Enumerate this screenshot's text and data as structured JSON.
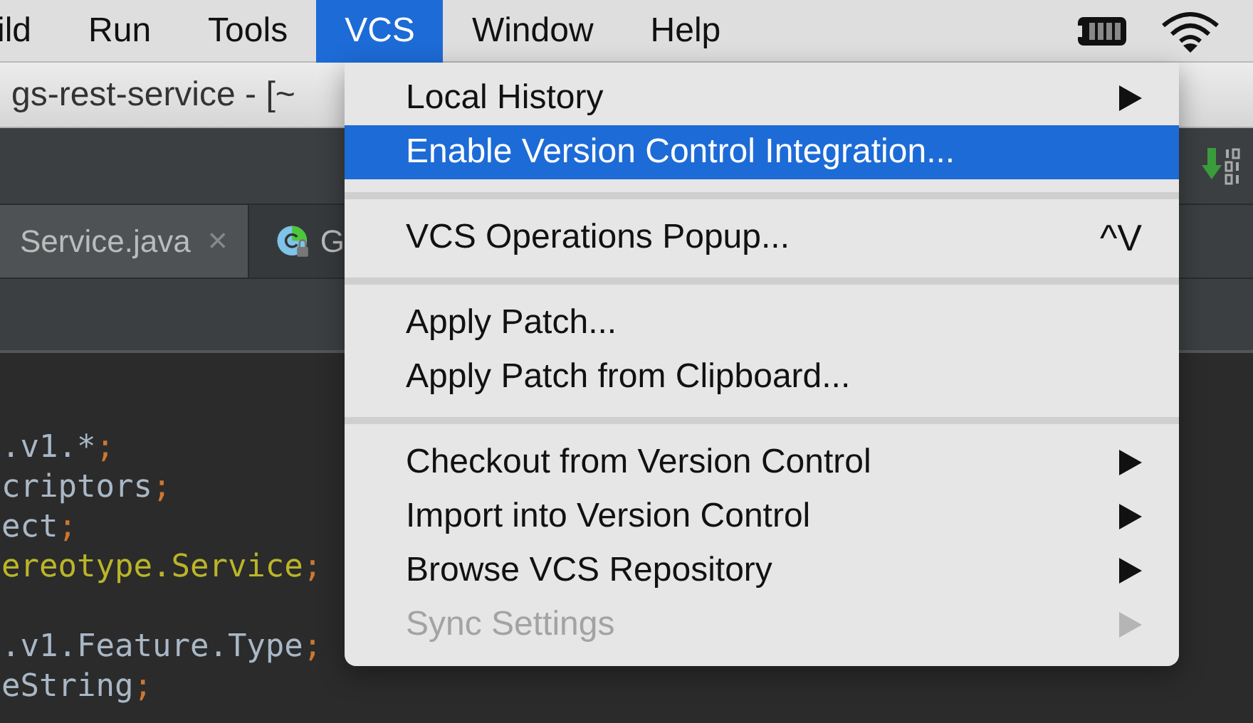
{
  "menubar": {
    "items": [
      {
        "label": "ild",
        "selected": false
      },
      {
        "label": "Run",
        "selected": false
      },
      {
        "label": "Tools",
        "selected": false
      },
      {
        "label": "VCS",
        "selected": true
      },
      {
        "label": "Window",
        "selected": false
      },
      {
        "label": "Help",
        "selected": false
      }
    ]
  },
  "window": {
    "title": "gs-rest-service - [~"
  },
  "tabs": [
    {
      "label": "Service.java",
      "close": "×",
      "selected": true
    },
    {
      "label": "G",
      "selected": false
    }
  ],
  "code_lines": [
    {
      "tokens": [
        {
          "text": ".v1.*",
          "kind": "plain"
        },
        {
          "text": ";",
          "kind": "punct"
        }
      ]
    },
    {
      "tokens": [
        {
          "text": "criptors",
          "kind": "plain"
        },
        {
          "text": ";",
          "kind": "punct"
        }
      ]
    },
    {
      "tokens": [
        {
          "text": "ect",
          "kind": "plain"
        },
        {
          "text": ";",
          "kind": "punct"
        }
      ]
    },
    {
      "tokens": [
        {
          "text": "ereotype.Service",
          "kind": "annotation"
        },
        {
          "text": ";",
          "kind": "punct"
        }
      ]
    },
    {
      "kind": "blank"
    },
    {
      "tokens": [
        {
          "text": ".v1.Feature.Type",
          "kind": "plain"
        },
        {
          "text": ";",
          "kind": "punct"
        }
      ]
    },
    {
      "tokens": [
        {
          "text": "eString",
          "kind": "plain"
        },
        {
          "text": ";",
          "kind": "punct"
        }
      ]
    }
  ],
  "menu": {
    "groups": [
      [
        {
          "label": "Local History",
          "submenu": true,
          "selected": false,
          "disabled": false
        },
        {
          "label": "Enable Version Control Integration...",
          "submenu": false,
          "selected": true,
          "disabled": false
        }
      ],
      [
        {
          "label": "VCS Operations Popup...",
          "shortcut": "^V",
          "submenu": false,
          "selected": false,
          "disabled": false
        }
      ],
      [
        {
          "label": "Apply Patch...",
          "submenu": false,
          "selected": false,
          "disabled": false
        },
        {
          "label": "Apply Patch from Clipboard...",
          "submenu": false,
          "selected": false,
          "disabled": false
        }
      ],
      [
        {
          "label": "Checkout from Version Control",
          "submenu": true,
          "selected": false,
          "disabled": false
        },
        {
          "label": "Import into Version Control",
          "submenu": true,
          "selected": false,
          "disabled": false
        },
        {
          "label": "Browse VCS Repository",
          "submenu": true,
          "selected": false,
          "disabled": false
        },
        {
          "label": "Sync Settings",
          "submenu": true,
          "selected": false,
          "disabled": true
        }
      ]
    ]
  }
}
